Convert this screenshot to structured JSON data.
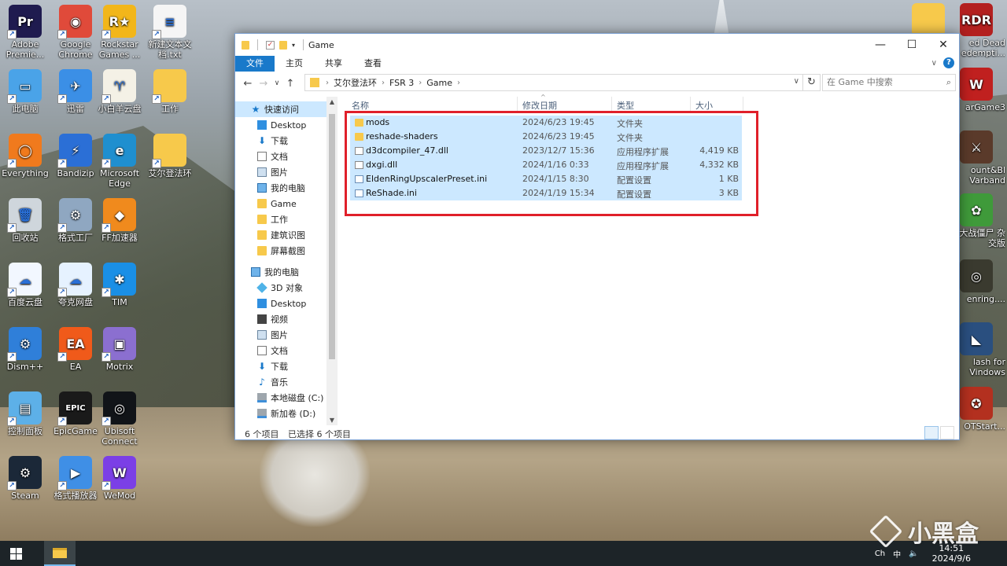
{
  "desktop": {
    "left_icons": [
      {
        "label": "Adobe Premie...",
        "glyph": "Pr",
        "color": "#1f1b4f",
        "icon": "premiere-icon"
      },
      {
        "label": "Google Chrome",
        "glyph": "◉",
        "color": "#e04a3a",
        "icon": "chrome-icon"
      },
      {
        "label": "Rockstar Games ...",
        "glyph": "R★",
        "color": "#f2b61a",
        "icon": "rockstar-icon"
      },
      {
        "label": "新建文本文档.txt",
        "glyph": "≡",
        "color": "#f5f5f5",
        "icon": "text-file-icon"
      },
      {
        "label": "此电脑",
        "glyph": "▭",
        "color": "#4aa3e8",
        "icon": "this-pc-icon"
      },
      {
        "label": "迅雷",
        "glyph": "✈",
        "color": "#3b8fe6",
        "icon": "xunlei-icon"
      },
      {
        "label": "小白羊云盘",
        "glyph": "♈",
        "color": "#f4f1e6",
        "icon": "aliyun-sheep-icon"
      },
      {
        "label": "工作",
        "glyph": "",
        "color": "#f7c94b",
        "icon": "folder-icon"
      },
      {
        "label": "Everything",
        "glyph": "◯",
        "color": "#f07a1d",
        "icon": "everything-icon"
      },
      {
        "label": "Bandizip",
        "glyph": "⚡",
        "color": "#2b6fd6",
        "icon": "bandizip-icon"
      },
      {
        "label": "Microsoft Edge",
        "glyph": "e",
        "color": "#1f8fcf",
        "icon": "edge-icon"
      },
      {
        "label": "艾尔登法环",
        "glyph": "",
        "color": "#f7c94b",
        "icon": "folder-icon"
      },
      {
        "label": "回收站",
        "glyph": "🗑",
        "color": "#cfd6dc",
        "icon": "recycle-bin-icon"
      },
      {
        "label": "格式工厂",
        "glyph": "⚙",
        "color": "#8fa7c1",
        "icon": "format-factory-icon"
      },
      {
        "label": "FF加速器",
        "glyph": "◆",
        "color": "#f08a1d",
        "icon": "ff-accelerator-icon"
      },
      {
        "label": "百度云盘",
        "glyph": "☁",
        "color": "#f2f7ff",
        "icon": "baidu-cloud-icon"
      },
      {
        "label": "夸克网盘",
        "glyph": "☁",
        "color": "#e6f2ff",
        "icon": "quark-cloud-icon"
      },
      {
        "label": "TIM",
        "glyph": "✱",
        "color": "#1a8fe6",
        "icon": "tim-icon"
      },
      {
        "label": "Dism++",
        "glyph": "⚙",
        "color": "#2f7fd9",
        "icon": "dism-icon"
      },
      {
        "label": "EA",
        "glyph": "EA",
        "color": "#f05a1a",
        "icon": "ea-icon"
      },
      {
        "label": "Motrix",
        "glyph": "▣",
        "color": "#8b6fd0",
        "icon": "motrix-icon"
      },
      {
        "label": "控制面板",
        "glyph": "▤",
        "color": "#5db0e8",
        "icon": "control-panel-icon"
      },
      {
        "label": "EpicGame",
        "glyph": "EPIC",
        "color": "#1a1a1a",
        "icon": "epic-icon"
      },
      {
        "label": "Ubisoft Connect",
        "glyph": "◎",
        "color": "#111418",
        "icon": "ubisoft-icon"
      },
      {
        "label": "Steam",
        "glyph": "⚙",
        "color": "#1b2838",
        "icon": "steam-icon"
      },
      {
        "label": "格式播放器",
        "glyph": "▶",
        "color": "#3f8fe6",
        "icon": "format-player-icon"
      },
      {
        "label": "WeMod",
        "glyph": "W",
        "color": "#7b3fe6",
        "icon": "wemod-icon"
      }
    ],
    "right_icons": [
      {
        "label": "",
        "glyph": "",
        "color": "#f7c94b",
        "icon": "folder-icon"
      },
      {
        "label": "ed Dead edempti...",
        "glyph": "RDR",
        "color": "#b3201f",
        "icon": "red-dead-icon"
      },
      {
        "label": "arGame3",
        "glyph": "W",
        "color": "#c0201f",
        "icon": "wargame-icon"
      },
      {
        "label": "ount&Bl Varband",
        "glyph": "⚔",
        "color": "#5a3a2a",
        "icon": "mount-blade-icon"
      },
      {
        "label": "植大战僵尸 杂交版",
        "glyph": "✿",
        "color": "#3f9a3a",
        "icon": "pvz-icon"
      },
      {
        "label": "enring....",
        "glyph": "◎",
        "color": "#3a3a2f",
        "icon": "eldenring-icon"
      },
      {
        "label": "lash for Vindows",
        "glyph": "◣",
        "color": "#2a4f7f",
        "icon": "clash-icon"
      },
      {
        "label": "OTStart...",
        "glyph": "✪",
        "color": "#b3301f",
        "icon": "otstart-icon"
      }
    ]
  },
  "window": {
    "title": "Game",
    "controls": {
      "minimize": "—",
      "maximize": "☐",
      "close": "✕"
    },
    "ribbon_tabs": [
      "文件",
      "主页",
      "共享",
      "查看"
    ],
    "address": {
      "crumbs": [
        "艾尔登法环",
        "FSR 3",
        "Game"
      ],
      "search_placeholder": "在 Game 中搜索"
    },
    "nav": {
      "quick_access": "快速访问",
      "quick_items": [
        {
          "label": "Desktop",
          "icon": "blue",
          "pin": true
        },
        {
          "label": "下载",
          "icon": "down",
          "pin": true
        },
        {
          "label": "文档",
          "icon": "doc",
          "pin": true
        },
        {
          "label": "图片",
          "icon": "pic",
          "pin": true
        },
        {
          "label": "我的电脑",
          "icon": "pc",
          "pin": true
        },
        {
          "label": "Game",
          "icon": "folder",
          "pin": false
        },
        {
          "label": "工作",
          "icon": "folder",
          "pin": false
        },
        {
          "label": "建筑识图",
          "icon": "folder",
          "pin": false
        },
        {
          "label": "屏幕截图",
          "icon": "folder",
          "pin": false
        }
      ],
      "this_pc": "我的电脑",
      "pc_items": [
        {
          "label": "3D 对象",
          "icon": "3d"
        },
        {
          "label": "Desktop",
          "icon": "blue"
        },
        {
          "label": "视频",
          "icon": "vid"
        },
        {
          "label": "图片",
          "icon": "pic"
        },
        {
          "label": "文档",
          "icon": "doc"
        },
        {
          "label": "下载",
          "icon": "down"
        },
        {
          "label": "音乐",
          "icon": "music"
        },
        {
          "label": "本地磁盘 (C:)",
          "icon": "drive"
        },
        {
          "label": "新加卷 (D:)",
          "icon": "drive"
        }
      ]
    },
    "columns": {
      "name": "名称",
      "date": "修改日期",
      "type": "类型",
      "size": "大小"
    },
    "files": [
      {
        "name": "mods",
        "date": "2024/6/23 19:45",
        "type": "文件夹",
        "size": "",
        "kind": "folder"
      },
      {
        "name": "reshade-shaders",
        "date": "2024/6/23 19:45",
        "type": "文件夹",
        "size": "",
        "kind": "folder"
      },
      {
        "name": "d3dcompiler_47.dll",
        "date": "2023/12/7 15:36",
        "type": "应用程序扩展",
        "size": "4,419 KB",
        "kind": "dll"
      },
      {
        "name": "dxgi.dll",
        "date": "2024/1/16 0:33",
        "type": "应用程序扩展",
        "size": "4,332 KB",
        "kind": "dll"
      },
      {
        "name": "EldenRingUpscalerPreset.ini",
        "date": "2024/1/15 8:30",
        "type": "配置设置",
        "size": "1 KB",
        "kind": "ini"
      },
      {
        "name": "ReShade.ini",
        "date": "2024/1/19 15:34",
        "type": "配置设置",
        "size": "3 KB",
        "kind": "ini"
      }
    ],
    "status": {
      "count": "6 个项目",
      "selected": "已选择 6 个项目"
    }
  },
  "taskbar": {
    "time": "14:51",
    "date": "2024/9/6",
    "ime": "中",
    "ime2": "Ch",
    "volume": "🔈",
    "notify": "▢"
  },
  "watermark": {
    "text": "小黑盒"
  }
}
